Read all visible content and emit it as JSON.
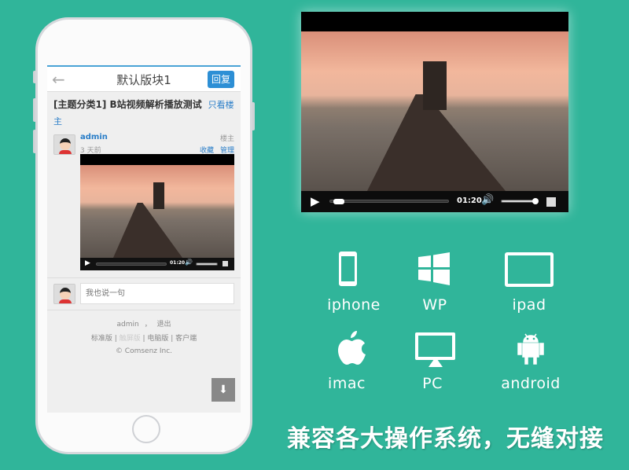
{
  "phone": {
    "header": {
      "title": "默认版块1",
      "back_icon": "arrow-left-icon",
      "reply_label": "回复"
    },
    "topic": {
      "title": "[主题分类1] B站视频解析播放测试",
      "only_author": "只看楼主"
    },
    "post": {
      "author": "admin",
      "time": "3 天前",
      "floor": "楼主",
      "favorite": "收藏",
      "manage": "管理"
    },
    "small_video": {
      "time": "01:20"
    },
    "comment": {
      "placeholder": "我也说一句"
    },
    "footer": {
      "user": "admin",
      "sep": "，",
      "logout": "退出",
      "versions": [
        "标准版",
        "触屏版",
        "电脑版",
        "客户端"
      ],
      "copyright": "© Comsenz Inc."
    }
  },
  "video": {
    "time": "01:20",
    "progress": 0.03,
    "volume": 0.95
  },
  "platforms": [
    {
      "label": "iphone",
      "icon": "iphone-icon"
    },
    {
      "label": "WP",
      "icon": "windows-icon"
    },
    {
      "label": "ipad",
      "icon": "ipad-icon"
    },
    {
      "label": "imac",
      "icon": "apple-icon"
    },
    {
      "label": "PC",
      "icon": "monitor-icon"
    },
    {
      "label": "android",
      "icon": "android-icon"
    }
  ],
  "slogan": "兼容各大操作系统，无缝对接",
  "colors": {
    "background": "#30b59a",
    "accent": "#2d8fd5"
  }
}
